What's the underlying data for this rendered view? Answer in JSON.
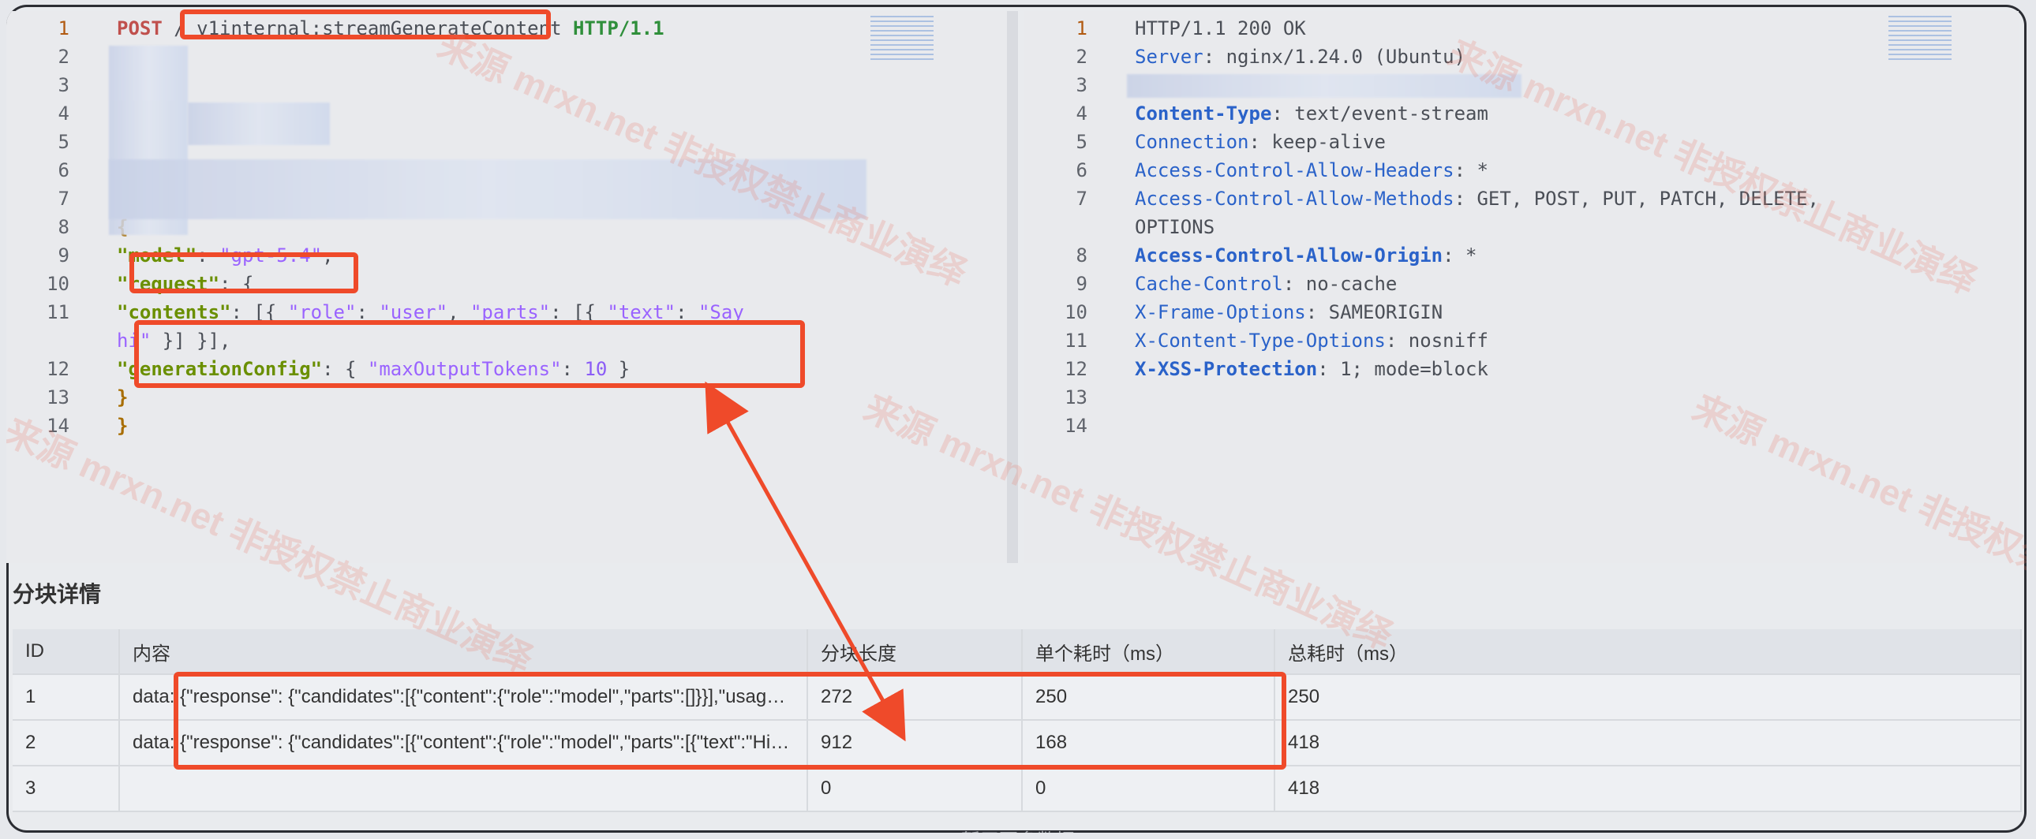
{
  "request_editor": {
    "lines": [
      {
        "n": "1",
        "content": [
          {
            "t": "POST",
            "c": "kw-post"
          },
          {
            "t": " / ",
            "c": ""
          },
          {
            "t": "v1internal:streamGenerateContent",
            "c": ""
          },
          {
            "t": " HTTP/1.1",
            "c": "http"
          }
        ]
      },
      {
        "n": "2",
        "content": []
      },
      {
        "n": "3",
        "content": []
      },
      {
        "n": "4",
        "content": []
      },
      {
        "n": "5",
        "content": []
      },
      {
        "n": "6",
        "content": []
      },
      {
        "n": "7",
        "content": []
      },
      {
        "n": "8",
        "content": [
          {
            "t": "{",
            "c": "brace"
          }
        ]
      },
      {
        "n": "9",
        "content": [
          {
            "t": "\"model\"",
            "c": "key"
          },
          {
            "t": ": ",
            "c": ""
          },
          {
            "t": "\"gpt-5.4\"",
            "c": "str"
          },
          {
            "t": ",",
            "c": ""
          }
        ]
      },
      {
        "n": "10",
        "content": [
          {
            "t": "\"request\"",
            "c": "key"
          },
          {
            "t": ": {",
            "c": ""
          }
        ]
      },
      {
        "n": "11",
        "content": [
          {
            "t": "\"contents\"",
            "c": "key"
          },
          {
            "t": ": [{ ",
            "c": ""
          },
          {
            "t": "\"role\"",
            "c": "str"
          },
          {
            "t": ": ",
            "c": ""
          },
          {
            "t": "\"user\"",
            "c": "str"
          },
          {
            "t": ", ",
            "c": ""
          },
          {
            "t": "\"parts\"",
            "c": "str"
          },
          {
            "t": ": [{ ",
            "c": ""
          },
          {
            "t": "\"text\"",
            "c": "str"
          },
          {
            "t": ": ",
            "c": ""
          },
          {
            "t": "\"Say",
            "c": "str"
          }
        ]
      },
      {
        "n": "",
        "content": [
          {
            "t": "hi\"",
            "c": "str"
          },
          {
            "t": " }] }],",
            "c": ""
          }
        ]
      },
      {
        "n": "12",
        "content": [
          {
            "t": "\"generationConfig\"",
            "c": "key"
          },
          {
            "t": ": { ",
            "c": ""
          },
          {
            "t": "\"maxOutputTokens\"",
            "c": "str"
          },
          {
            "t": ": ",
            "c": ""
          },
          {
            "t": "10",
            "c": "num"
          },
          {
            "t": " }",
            "c": ""
          }
        ]
      },
      {
        "n": "13",
        "content": [
          {
            "t": "}",
            "c": "brace"
          }
        ]
      },
      {
        "n": "14",
        "content": [
          {
            "t": "}",
            "c": "brace"
          }
        ]
      }
    ]
  },
  "response_editor": {
    "lines": [
      {
        "n": "1",
        "content": [
          {
            "t": "HTTP/1.1 200 OK",
            "c": ""
          }
        ]
      },
      {
        "n": "2",
        "content": [
          {
            "t": "Server",
            "c": "header"
          },
          {
            "t": ": nginx/1.24.0 (Ubuntu)",
            "c": ""
          }
        ]
      },
      {
        "n": "3",
        "content": []
      },
      {
        "n": "4",
        "content": [
          {
            "t": "Content-Type",
            "c": "header bold"
          },
          {
            "t": ": text/event-stream",
            "c": ""
          }
        ]
      },
      {
        "n": "5",
        "content": [
          {
            "t": "Connection",
            "c": "header"
          },
          {
            "t": ": keep-alive",
            "c": ""
          }
        ]
      },
      {
        "n": "6",
        "content": [
          {
            "t": "Access-Control-Allow-Headers",
            "c": "header"
          },
          {
            "t": ": *",
            "c": ""
          }
        ]
      },
      {
        "n": "7",
        "content": [
          {
            "t": "Access-Control-Allow-Methods",
            "c": "header"
          },
          {
            "t": ": GET, POST, PUT, PATCH, DELETE,",
            "c": ""
          }
        ]
      },
      {
        "n": "",
        "content": [
          {
            "t": "OPTIONS",
            "c": ""
          }
        ]
      },
      {
        "n": "8",
        "content": [
          {
            "t": "Access-Control-Allow-Origin",
            "c": "header bold"
          },
          {
            "t": ": *",
            "c": ""
          }
        ]
      },
      {
        "n": "9",
        "content": [
          {
            "t": "Cache-Control",
            "c": "header"
          },
          {
            "t": ": no-cache",
            "c": ""
          }
        ]
      },
      {
        "n": "10",
        "content": [
          {
            "t": "X-Frame-Options",
            "c": "header"
          },
          {
            "t": ": SAMEORIGIN",
            "c": ""
          }
        ]
      },
      {
        "n": "11",
        "content": [
          {
            "t": "X-Content-Type-Options",
            "c": "header"
          },
          {
            "t": ": nosniff",
            "c": ""
          }
        ]
      },
      {
        "n": "12",
        "content": [
          {
            "t": "X-XSS-Protection",
            "c": "header bold"
          },
          {
            "t": ": 1; mode=block",
            "c": ""
          }
        ]
      },
      {
        "n": "13",
        "content": []
      },
      {
        "n": "14",
        "content": []
      }
    ]
  },
  "chunk_details": {
    "title": "分块详情",
    "columns": [
      "ID",
      "内容",
      "分块长度",
      "单个耗时（ms）",
      "总耗时（ms）"
    ],
    "rows": [
      [
        "1",
        "data: {\"response\": {\"candidates\":[{\"content\":{\"role\":\"model\",\"parts\":[]}}],\"usageMetadata\":{\"trafficType\":\"PROVISIONE…",
        "272",
        "250",
        "250"
      ],
      [
        "2",
        "data: {\"response\": {\"candidates\":[{\"content\":{\"role\":\"model\",\"parts\":[{\"text\":\"Hi\"}]}}],\"usageMetadata\":{\"trafficType\":\"P…",
        "912",
        "168",
        "418"
      ],
      [
        "3",
        "",
        "0",
        "0",
        "418"
      ]
    ],
    "more_label": "暂无更多数据"
  },
  "watermark_text": "来源 mrxn.net 非授权禁止商业演绎",
  "colors": {
    "highlight": "#ef4a2a"
  }
}
